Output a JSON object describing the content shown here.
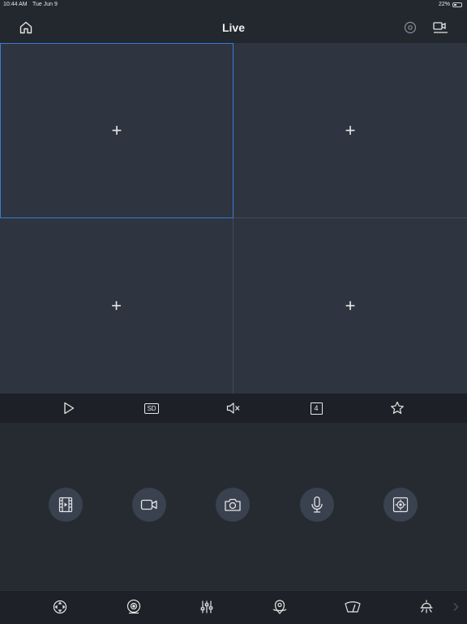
{
  "status": {
    "time": "10:44 AM",
    "date": "Tue Jun 9",
    "battery": "22%"
  },
  "header": {
    "title": "Live"
  },
  "grid": {
    "cells": [
      "+",
      "+",
      "+",
      "+"
    ]
  },
  "toolbar": {
    "sd_label": "SD",
    "split_label": "4"
  },
  "colors": {
    "background": "#23272e",
    "grid": "#2e3440",
    "selected_border": "#3a7bd5",
    "circle": "#3a4250"
  },
  "icons": {
    "header": [
      "home-icon",
      "settings-icon",
      "device-list-icon"
    ],
    "toolbar": [
      "play-icon",
      "sd-quality-icon",
      "mute-icon",
      "split-screen-icon",
      "favorite-star-icon"
    ],
    "controls": [
      "film-playback-icon",
      "record-video-icon",
      "snapshot-camera-icon",
      "microphone-icon",
      "target-capture-icon"
    ],
    "bottom": [
      "ptz-direction-icon",
      "camera-eye-icon",
      "sliders-icon",
      "location-pin-icon",
      "wiper-icon",
      "light-icon",
      "chevron-right-icon"
    ]
  }
}
